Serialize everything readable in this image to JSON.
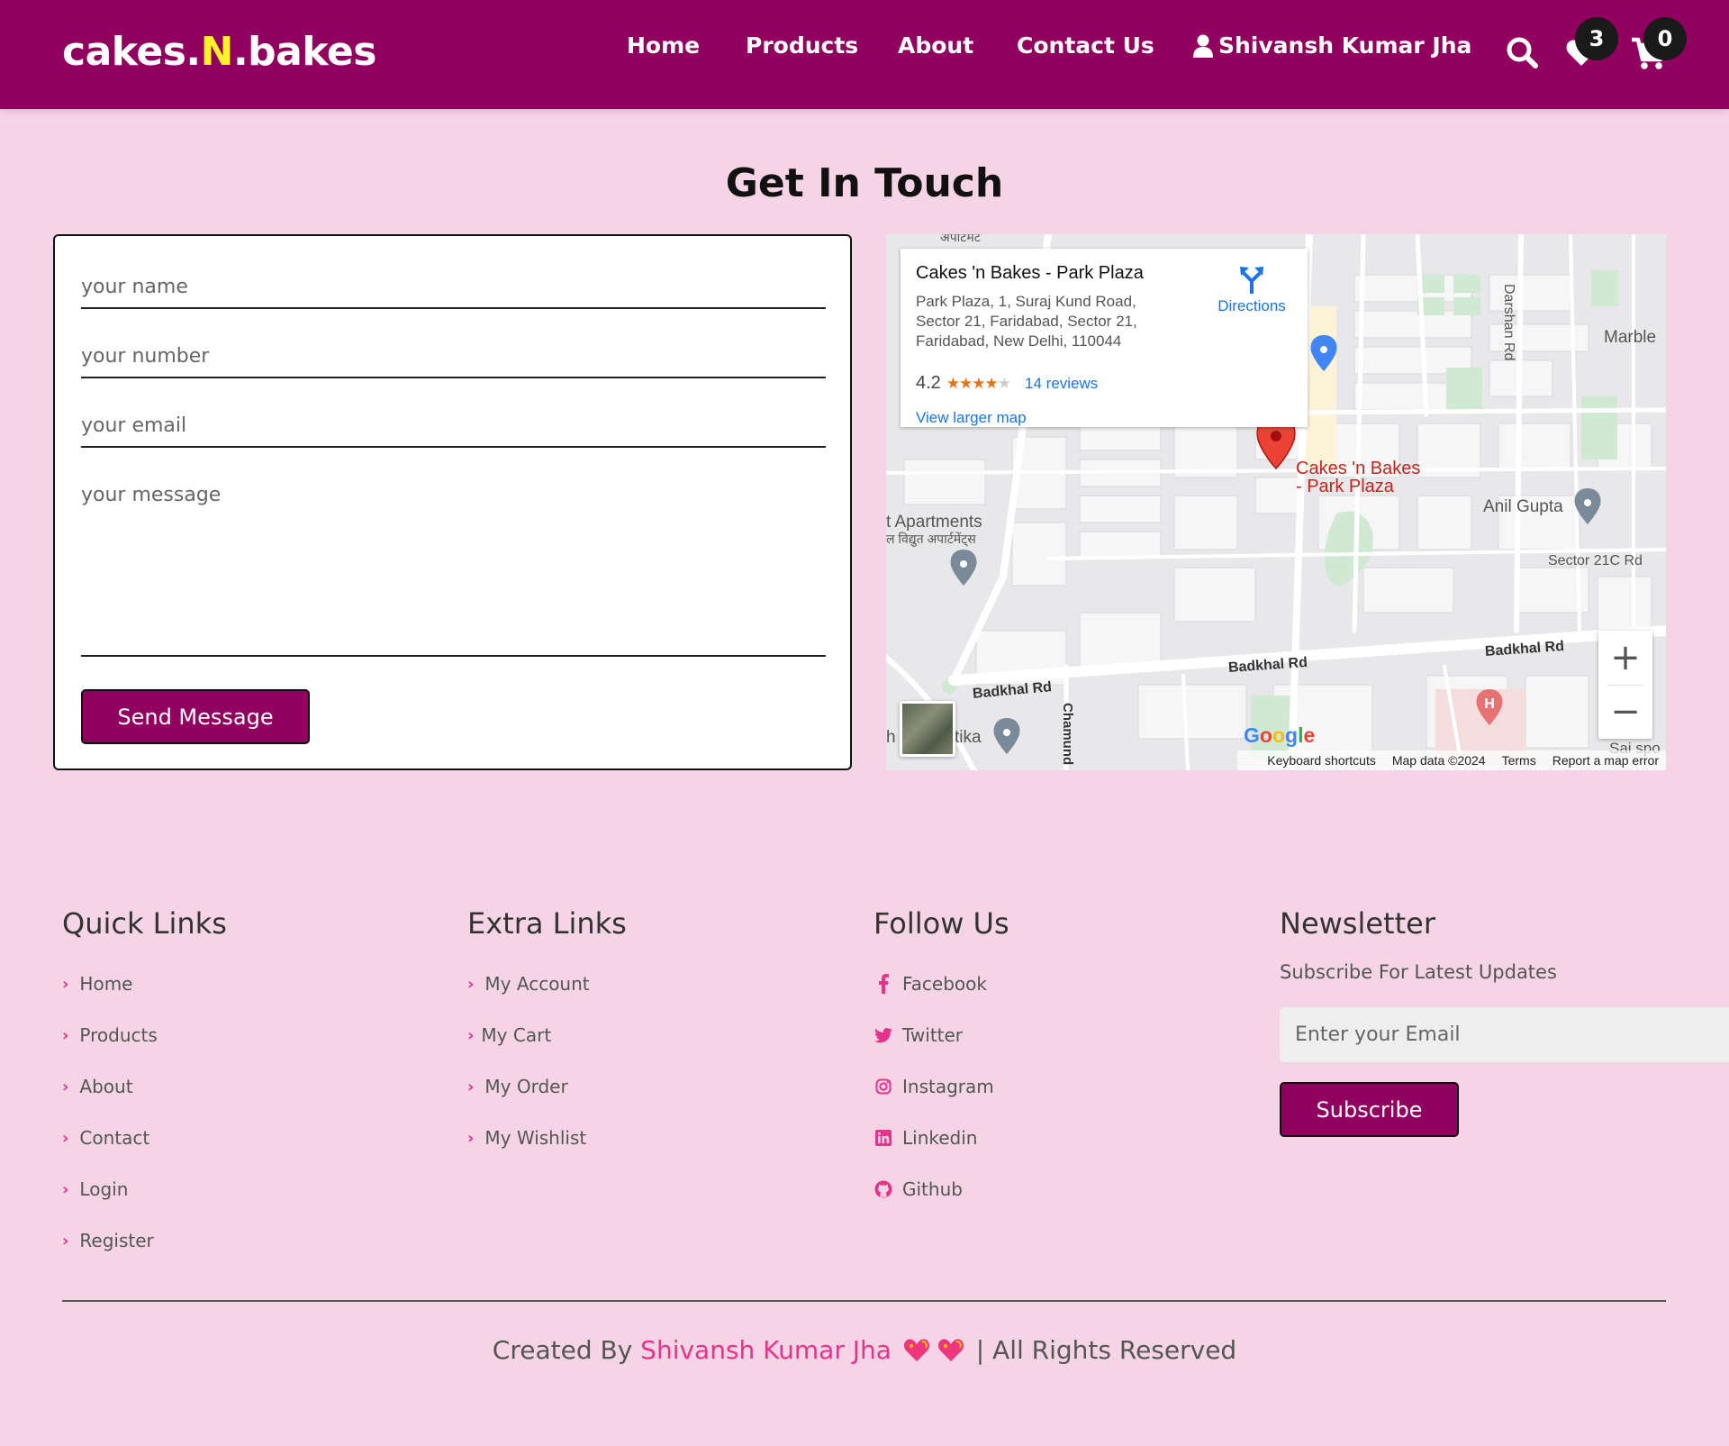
{
  "header": {
    "logo": {
      "part1": "cakes.",
      "part2": "N",
      "part3": ".bakes"
    },
    "nav": [
      {
        "label": "Home"
      },
      {
        "label": "Products"
      },
      {
        "label": "About"
      },
      {
        "label": "Contact Us"
      }
    ],
    "user_name": "Shivansh Kumar Jha",
    "wishlist_count": "3",
    "cart_count": "0",
    "icons": [
      "user-icon",
      "search-icon",
      "heart-icon",
      "cart-icon"
    ]
  },
  "page_title": "Get In Touch",
  "form": {
    "name_placeholder": "your name",
    "number_placeholder": "your number",
    "email_placeholder": "your email",
    "message_placeholder": "your message",
    "send_label": "Send Message"
  },
  "map": {
    "place_name": "Cakes 'n Bakes - Park Plaza",
    "address": "Park Plaza, 1, Suraj Kund Road, Sector 21, Faridabad, Sector 21, Faridabad, New Delhi, 110044",
    "rating": "4.2",
    "stars": "★★★★",
    "star_empty": "★",
    "reviews": "14 reviews",
    "view_larger": "View larger map",
    "directions": "Directions",
    "marker_label_1": "Cakes 'n Bakes",
    "marker_label_2": "- Park Plaza",
    "labels": {
      "marble": "Marble",
      "anil": "Anil Gupta",
      "sector21c": "Sector 21C Rd",
      "apartments": "t Apartments",
      "apartments_hi": "ल विद्युत अपार्टमेंट्स",
      "top_hi": "अपार्टमेंट",
      "darshan": "Darshan Rd",
      "badkhal1": "Badkhal Rd",
      "badkhal2": "Badkhal Rd",
      "badkhal3": "Badkhal Rd",
      "chamund": "Chamund",
      "vatika": "tika",
      "vatika_h": "h",
      "sai": "Sai spo"
    },
    "google": "Google",
    "footer": {
      "shortcuts": "Keyboard shortcuts",
      "data": "Map data ©2024",
      "terms": "Terms",
      "report": "Report a map error"
    },
    "zoom_in": "+",
    "zoom_out": "−"
  },
  "footer": {
    "quick_links": {
      "title": "Quick Links",
      "items": [
        "Home",
        "Products",
        "About",
        "Contact",
        "Login",
        "Register"
      ]
    },
    "extra_links": {
      "title": "Extra Links",
      "items": [
        "My Account",
        "My Cart",
        "My Order",
        "My Wishlist"
      ]
    },
    "follow_us": {
      "title": "Follow Us",
      "items": [
        {
          "label": "Facebook",
          "icon": "facebook-icon"
        },
        {
          "label": "Twitter",
          "icon": "twitter-icon"
        },
        {
          "label": "Instagram",
          "icon": "instagram-icon"
        },
        {
          "label": "Linkedin",
          "icon": "linkedin-icon"
        },
        {
          "label": "Github",
          "icon": "github-icon"
        }
      ]
    },
    "newsletter": {
      "title": "Newsletter",
      "subtitle": "Subscribe For Latest Updates",
      "placeholder": "Enter your Email",
      "button": "Subscribe"
    },
    "credits": {
      "prefix": "Created By ",
      "author": "Shivansh Kumar Jha",
      "suffix": " | All Rights Reserved"
    }
  },
  "colors": {
    "brand": "#92005f",
    "background": "#f5d5e5",
    "logo_accent": "#fff12a",
    "link_accent": "#e6338a"
  }
}
